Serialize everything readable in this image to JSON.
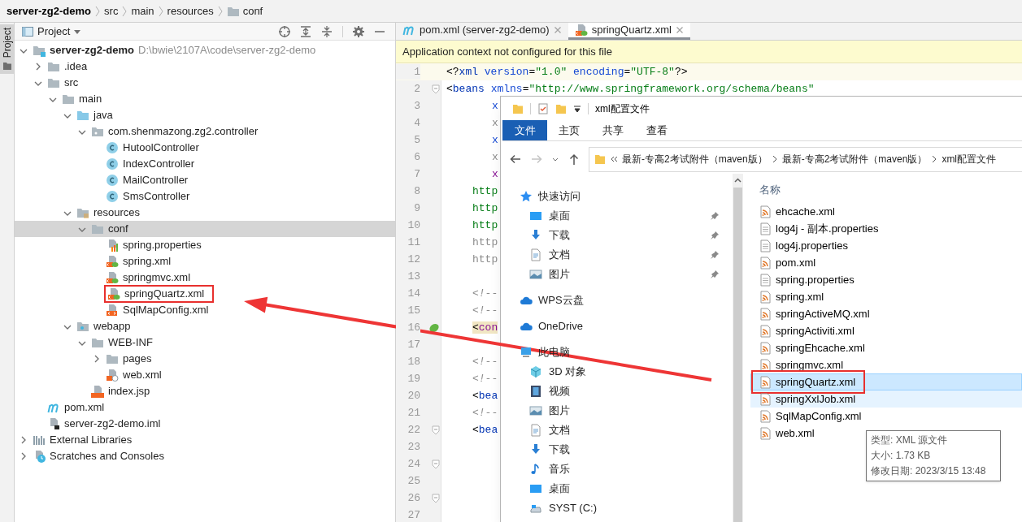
{
  "breadcrumb": [
    {
      "label": "server-zg2-demo",
      "kind": "project"
    },
    {
      "label": "src",
      "kind": "plain"
    },
    {
      "label": "main",
      "kind": "plain"
    },
    {
      "label": "resources",
      "kind": "plain"
    },
    {
      "label": "conf",
      "kind": "folder"
    }
  ],
  "side_tab": {
    "label": "Project",
    "selected": true
  },
  "project_panel": {
    "title": "Project",
    "tree": [
      {
        "label": "server-zg2-demo",
        "path": "D:\\bwie\\2107A\\code\\server-zg2-demo",
        "kind": "module",
        "expanded": true,
        "selected": false,
        "annotated": false,
        "children": [
          {
            "label": ".idea",
            "kind": "folder",
            "expanded": false,
            "selected": false,
            "annotated": false
          },
          {
            "label": "src",
            "kind": "folder",
            "expanded": true,
            "selected": false,
            "annotated": false,
            "children": [
              {
                "label": "main",
                "kind": "folder",
                "expanded": true,
                "selected": false,
                "annotated": false,
                "children": [
                  {
                    "label": "java",
                    "kind": "source-folder",
                    "expanded": true,
                    "selected": false,
                    "annotated": false,
                    "children": [
                      {
                        "label": "com.shenmazong.zg2.controller",
                        "kind": "package",
                        "expanded": true,
                        "selected": false,
                        "annotated": false,
                        "children": [
                          {
                            "label": "HutoolController",
                            "kind": "class",
                            "selected": false,
                            "annotated": false
                          },
                          {
                            "label": "IndexController",
                            "kind": "class",
                            "selected": false,
                            "annotated": false
                          },
                          {
                            "label": "MailController",
                            "kind": "class",
                            "selected": false,
                            "annotated": false
                          },
                          {
                            "label": "SmsController",
                            "kind": "class",
                            "selected": false,
                            "annotated": false
                          }
                        ]
                      }
                    ]
                  },
                  {
                    "label": "resources",
                    "kind": "resources-folder",
                    "expanded": true,
                    "selected": false,
                    "annotated": false,
                    "children": [
                      {
                        "label": "conf",
                        "kind": "folder",
                        "expanded": true,
                        "selected": true,
                        "annotated": false,
                        "children": [
                          {
                            "label": "spring.properties",
                            "kind": "properties",
                            "selected": false,
                            "annotated": false
                          },
                          {
                            "label": "spring.xml",
                            "kind": "spring-xml",
                            "selected": false,
                            "annotated": false
                          },
                          {
                            "label": "springmvc.xml",
                            "kind": "spring-xml",
                            "selected": false,
                            "annotated": false
                          },
                          {
                            "label": "springQuartz.xml",
                            "kind": "spring-xml",
                            "selected": false,
                            "annotated": true
                          },
                          {
                            "label": "SqlMapConfig.xml",
                            "kind": "xml",
                            "selected": false,
                            "annotated": false
                          }
                        ]
                      }
                    ]
                  },
                  {
                    "label": "webapp",
                    "kind": "web-folder",
                    "expanded": true,
                    "selected": false,
                    "annotated": false,
                    "children": [
                      {
                        "label": "WEB-INF",
                        "kind": "folder",
                        "expanded": true,
                        "selected": false,
                        "annotated": false,
                        "children": [
                          {
                            "label": "pages",
                            "kind": "folder",
                            "expanded": false,
                            "selected": false,
                            "annotated": false
                          },
                          {
                            "label": "web.xml",
                            "kind": "web-xml",
                            "selected": false,
                            "annotated": false
                          }
                        ]
                      },
                      {
                        "label": "index.jsp",
                        "kind": "jsp",
                        "selected": false,
                        "annotated": false
                      }
                    ]
                  }
                ]
              }
            ]
          },
          {
            "label": "pom.xml",
            "kind": "maven",
            "selected": false,
            "annotated": false
          },
          {
            "label": "server-zg2-demo.iml",
            "kind": "iml",
            "selected": false,
            "annotated": false
          }
        ]
      },
      {
        "label": "External Libraries",
        "kind": "libraries",
        "expanded": false,
        "selected": false,
        "annotated": false
      },
      {
        "label": "Scratches and Consoles",
        "kind": "scratches",
        "expanded": false,
        "selected": false,
        "annotated": false
      }
    ]
  },
  "editor": {
    "tabs": [
      {
        "label": "pom.xml (server-zg2-demo)",
        "kind": "maven",
        "selected": false
      },
      {
        "label": "springQuartz.xml",
        "kind": "spring-xml",
        "selected": true
      }
    ],
    "banner": "Application context not configured for this file",
    "lines": [
      {
        "n": "1",
        "kind": "top",
        "current": true,
        "tokens": [
          {
            "t": "<?",
            "kind": "punct"
          },
          {
            "t": "xml",
            "kind": "tag"
          },
          {
            "t": " version",
            "kind": "attr"
          },
          {
            "t": "=",
            "kind": "punct"
          },
          {
            "t": "\"1.0\"",
            "kind": "value"
          },
          {
            "t": " encoding",
            "kind": "attr"
          },
          {
            "t": "=",
            "kind": "punct"
          },
          {
            "t": "\"UTF-8\"",
            "kind": "value"
          },
          {
            "t": "?>",
            "kind": "punct"
          }
        ]
      },
      {
        "n": "2",
        "kind": "top",
        "current": false,
        "marker": {
          "kind": "fold"
        },
        "tokens": [
          {
            "t": "<",
            "kind": "punct"
          },
          {
            "t": "beans",
            "kind": "tag"
          },
          {
            "t": " xmlns",
            "kind": "attr"
          },
          {
            "t": "=",
            "kind": "punct"
          },
          {
            "t": "\"http://www.springframework.org/schema/beans\"",
            "kind": "value"
          }
        ]
      },
      {
        "n": "3",
        "kind": "attr",
        "current": false,
        "tokens": [
          {
            "t": "x",
            "kind": "attr"
          }
        ]
      },
      {
        "n": "4",
        "kind": "attr",
        "current": false,
        "tokens": [
          {
            "t": "x",
            "kind": "dim"
          }
        ]
      },
      {
        "n": "5",
        "kind": "attr",
        "current": false,
        "tokens": [
          {
            "t": "x",
            "kind": "attr"
          }
        ]
      },
      {
        "n": "6",
        "kind": "attr",
        "current": false,
        "tokens": [
          {
            "t": "x",
            "kind": "dim"
          }
        ]
      },
      {
        "n": "7",
        "kind": "attr",
        "current": false,
        "tokens": [
          {
            "t": "x",
            "kind": "ns"
          }
        ]
      },
      {
        "n": "8",
        "kind": "body",
        "current": false,
        "tokens": [
          {
            "t": "http",
            "kind": "value"
          }
        ]
      },
      {
        "n": "9",
        "kind": "body",
        "current": false,
        "tokens": [
          {
            "t": "http",
            "kind": "value"
          }
        ]
      },
      {
        "n": "10",
        "kind": "body",
        "current": false,
        "tokens": [
          {
            "t": "http",
            "kind": "value"
          }
        ]
      },
      {
        "n": "11",
        "kind": "body",
        "current": false,
        "tokens": [
          {
            "t": "http",
            "kind": "dim"
          }
        ]
      },
      {
        "n": "12",
        "kind": "body",
        "current": false,
        "tokens": [
          {
            "t": "http",
            "kind": "dim"
          }
        ]
      },
      {
        "n": "13",
        "kind": "body",
        "current": false
      },
      {
        "n": "14",
        "kind": "body",
        "current": false,
        "tokens": [
          {
            "t": "<!--",
            "kind": "comment"
          }
        ]
      },
      {
        "n": "15",
        "kind": "body",
        "current": false,
        "tokens": [
          {
            "t": "<!--",
            "kind": "comment"
          }
        ]
      },
      {
        "n": "16",
        "kind": "body",
        "current": false,
        "marker": {
          "kind": "bean"
        },
        "tokens": [
          {
            "t": "<",
            "kind": "mark"
          },
          {
            "t": "con",
            "kind": "marktag"
          }
        ]
      },
      {
        "n": "17",
        "kind": "body",
        "current": false
      },
      {
        "n": "18",
        "kind": "body",
        "current": false,
        "tokens": [
          {
            "t": "<!--",
            "kind": "comment"
          }
        ]
      },
      {
        "n": "19",
        "kind": "body",
        "current": false,
        "tokens": [
          {
            "t": "<!--",
            "kind": "comment"
          }
        ]
      },
      {
        "n": "20",
        "kind": "body",
        "current": false,
        "tokens": [
          {
            "t": "<",
            "kind": "punct"
          },
          {
            "t": "bea",
            "kind": "tag"
          }
        ]
      },
      {
        "n": "21",
        "kind": "body",
        "current": false,
        "tokens": [
          {
            "t": "<!--",
            "kind": "comment"
          }
        ]
      },
      {
        "n": "22",
        "kind": "body",
        "current": false,
        "marker": {
          "kind": "fold"
        },
        "tokens": [
          {
            "t": "<",
            "kind": "punct"
          },
          {
            "t": "bea",
            "kind": "tag"
          }
        ]
      },
      {
        "n": "23",
        "kind": "body",
        "current": false
      },
      {
        "n": "24",
        "kind": "body",
        "current": false,
        "marker": {
          "kind": "fold"
        }
      },
      {
        "n": "25",
        "kind": "body",
        "current": false
      },
      {
        "n": "26",
        "kind": "body",
        "current": false,
        "marker": {
          "kind": "fold"
        }
      },
      {
        "n": "27",
        "kind": "body",
        "current": false
      }
    ]
  },
  "explorer": {
    "title": "xml配置文件",
    "ribbon_tabs": [
      {
        "label": "文件",
        "selected": true
      },
      {
        "label": "主页",
        "selected": false
      },
      {
        "label": "共享",
        "selected": false
      },
      {
        "label": "查看",
        "selected": false
      }
    ],
    "address": [
      "最新-专高2考试附件（maven版）",
      "最新-专高2考试附件（maven版）",
      "xml配置文件"
    ],
    "nav": [
      {
        "label": "快速访问",
        "kind": "star",
        "children": [
          {
            "label": "桌面",
            "kind": "desktop",
            "pinned": true
          },
          {
            "label": "下载",
            "kind": "download",
            "pinned": true
          },
          {
            "label": "文档",
            "kind": "document",
            "pinned": true
          },
          {
            "label": "图片",
            "kind": "pictures",
            "pinned": true
          }
        ]
      },
      {
        "label": "WPS云盘",
        "kind": "cloud"
      },
      {
        "label": "OneDrive",
        "kind": "cloud"
      },
      {
        "label": "此电脑",
        "kind": "computer",
        "children": [
          {
            "label": "3D 对象",
            "kind": "cube",
            "pinned": false
          },
          {
            "label": "视频",
            "kind": "video",
            "pinned": false
          },
          {
            "label": "图片",
            "kind": "pictures",
            "pinned": false
          },
          {
            "label": "文档",
            "kind": "document",
            "pinned": false
          },
          {
            "label": "下载",
            "kind": "download",
            "pinned": false
          },
          {
            "label": "音乐",
            "kind": "music",
            "pinned": false
          },
          {
            "label": "桌面",
            "kind": "desktop",
            "pinned": false
          },
          {
            "label": "SYST (C:)",
            "kind": "drive",
            "pinned": false
          }
        ]
      }
    ],
    "column": "名称",
    "files": [
      {
        "name": "ehcache.xml",
        "kind": "xml",
        "selected": false,
        "hovered": false,
        "annotated": false
      },
      {
        "name": "log4j - 副本.properties",
        "kind": "text",
        "selected": false,
        "hovered": false,
        "annotated": false
      },
      {
        "name": "log4j.properties",
        "kind": "text",
        "selected": false,
        "hovered": false,
        "annotated": false
      },
      {
        "name": "pom.xml",
        "kind": "xml",
        "selected": false,
        "hovered": false,
        "annotated": false
      },
      {
        "name": "spring.properties",
        "kind": "text",
        "selected": false,
        "hovered": false,
        "annotated": false
      },
      {
        "name": "spring.xml",
        "kind": "xml",
        "selected": false,
        "hovered": false,
        "annotated": false
      },
      {
        "name": "springActiveMQ.xml",
        "kind": "xml",
        "selected": false,
        "hovered": false,
        "annotated": false
      },
      {
        "name": "springActiviti.xml",
        "kind": "xml",
        "selected": false,
        "hovered": false,
        "annotated": false
      },
      {
        "name": "springEhcache.xml",
        "kind": "xml",
        "selected": false,
        "hovered": false,
        "annotated": false
      },
      {
        "name": "springmvc.xml",
        "kind": "xml",
        "selected": false,
        "hovered": false,
        "annotated": false
      },
      {
        "name": "springQuartz.xml",
        "kind": "xml",
        "selected": true,
        "hovered": false,
        "annotated": true
      },
      {
        "name": "springXxlJob.xml",
        "kind": "xml",
        "selected": false,
        "hovered": true,
        "annotated": false
      },
      {
        "name": "SqlMapConfig.xml",
        "kind": "xml",
        "selected": false,
        "hovered": false,
        "annotated": false
      },
      {
        "name": "web.xml",
        "kind": "xml",
        "selected": false,
        "hovered": false,
        "annotated": false
      }
    ],
    "tooltip": [
      "类型: XML 源文件",
      "大小: 1.73 KB",
      "修改日期: 2023/3/15 13:48"
    ]
  }
}
